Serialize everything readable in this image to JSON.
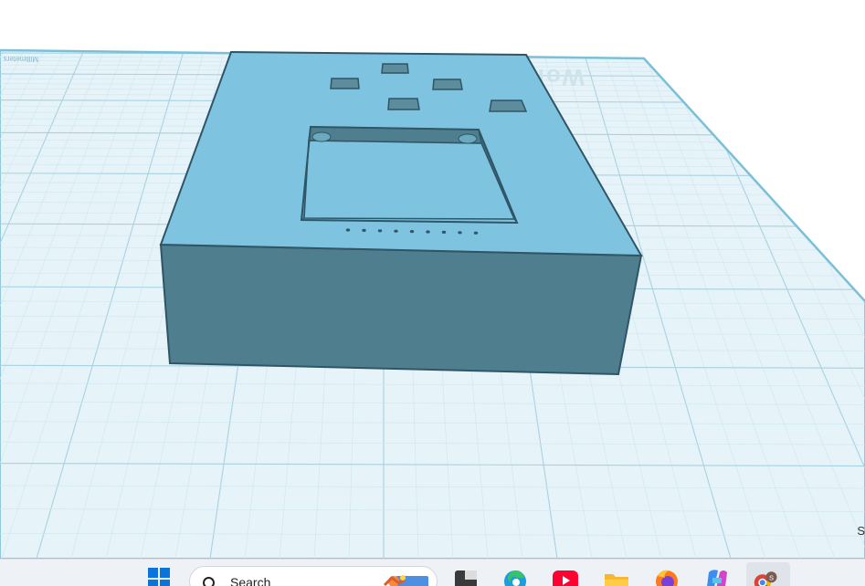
{
  "viewport": {
    "workplane_watermark": "Work",
    "workplane_ruler_text": "Millimeters",
    "corner_text": "S",
    "colors": {
      "background": "#ffffff",
      "workplane": "#e6f3f8",
      "grid_minor": "#cfe6ef",
      "grid_major": "#a9d2e1",
      "workplane_edge": "#8fc7dc",
      "shape_top": "#7ec4e0",
      "shape_front": "#4f7f8f",
      "shape_outline": "#2f5566"
    }
  },
  "taskbar": {
    "search_label": "Search",
    "avatar_letter": "S",
    "apps": [
      {
        "name": "start-button",
        "icon": "windows-logo-icon"
      },
      {
        "name": "search-box",
        "icon": "search-icon"
      },
      {
        "name": "taskbar-app-terminal",
        "icon": "terminal-icon"
      },
      {
        "name": "taskbar-app-edge",
        "icon": "edge-icon"
      },
      {
        "name": "taskbar-app-youtube",
        "icon": "youtube-icon"
      },
      {
        "name": "taskbar-app-file-explorer",
        "icon": "folder-icon"
      },
      {
        "name": "taskbar-app-firefox",
        "icon": "firefox-icon"
      },
      {
        "name": "taskbar-app-copilot",
        "icon": "copilot-icon"
      },
      {
        "name": "taskbar-app-chrome",
        "icon": "chrome-icon"
      }
    ]
  }
}
